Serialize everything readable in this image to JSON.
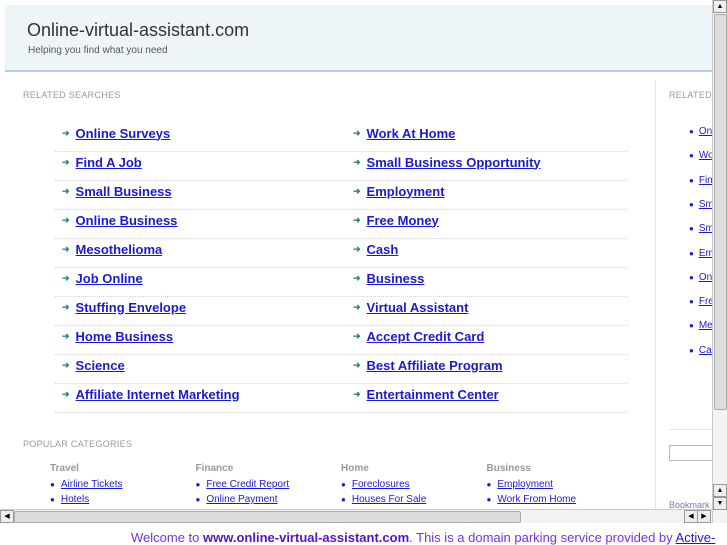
{
  "header": {
    "title": "Online-virtual-assistant.com",
    "tagline": "Helping you find what you need"
  },
  "related": {
    "label": "RELATED SEARCHES",
    "left": [
      "Online Surveys",
      "Find A Job",
      "Small Business",
      "Online Business",
      "Mesothelioma",
      "Job Online",
      "Stuffing Envelope",
      "Home Business",
      "Science",
      "Affiliate Internet Marketing"
    ],
    "right": [
      "Work At Home",
      "Small Business Opportunity",
      "Employment",
      "Free Money",
      "Cash",
      "Business",
      "Virtual Assistant",
      "Accept Credit Card",
      "Best Affiliate Program",
      "Entertainment Center"
    ]
  },
  "sidebar": {
    "label": "RELATED",
    "items": [
      "Online Surveys",
      "Work At Home",
      "Find A Job",
      "Small Business",
      "Small Business Opportunity",
      "Employment",
      "Online Business",
      "Free Money",
      "Mesothelioma",
      "Cash"
    ],
    "bookmark": "Bookmark"
  },
  "popular": {
    "label": "POPULAR CATEGORIES",
    "cats": [
      {
        "title": "Travel",
        "items": [
          "Airline Tickets",
          "Hotels"
        ]
      },
      {
        "title": "Finance",
        "items": [
          "Free Credit Report",
          "Online Payment"
        ]
      },
      {
        "title": "Home",
        "items": [
          "Foreclosures",
          "Houses For Sale"
        ]
      },
      {
        "title": "Business",
        "items": [
          "Employment",
          "Work From Home"
        ]
      }
    ]
  },
  "footer": {
    "pre": "Welcome to ",
    "domain": "www.online-virtual-assistant.com",
    "post": ". This is a domain parking service provided by ",
    "link": "Active-"
  }
}
